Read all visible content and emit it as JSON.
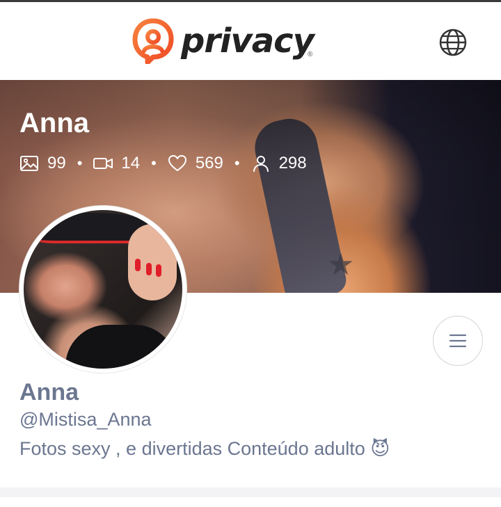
{
  "header": {
    "brand": "privacy",
    "registered": "®",
    "icons": {
      "logo": "privacy-logo-mark",
      "language": "globe-icon"
    },
    "colors": {
      "brand_orange": "#f5622c",
      "brand_text": "#222222"
    }
  },
  "banner": {
    "name": "Anna",
    "stats": {
      "photos": "99",
      "videos": "14",
      "likes": "569",
      "followers": "298"
    },
    "separator": "•"
  },
  "profile": {
    "name": "Anna",
    "handle": "@Mistisa_Anna",
    "bio": "Fotos sexy , e divertidas Conteúdo adulto 😈",
    "menu_icon": "menu-icon"
  },
  "colors": {
    "profile_text": "#6b7690"
  }
}
